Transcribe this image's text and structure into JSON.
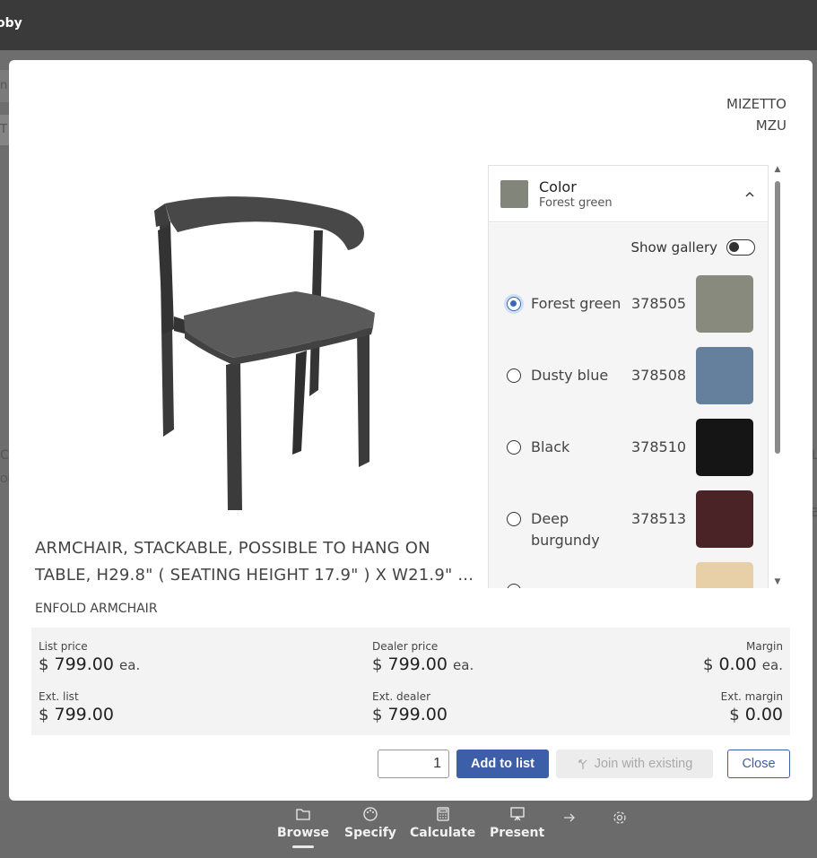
{
  "app": {
    "name": "oby"
  },
  "background": {
    "left_fragments": [
      "n",
      "T",
      "C",
      "OL"
    ],
    "right_fragments": [
      "L",
      "a"
    ]
  },
  "vendor": {
    "name": "MIZETTO",
    "code": "MZU"
  },
  "product": {
    "description": "ARMCHAIR, STACKABLE, POSSIBLE TO HANG ON TABLE, H29.8\" ( SEATING HEIGHT 17.9\" ) X W21.9\" ...",
    "name": "ENFOLD ARMCHAIR"
  },
  "option": {
    "title": "Color",
    "selected": "Forest green",
    "selected_color": "#82867a",
    "gallery_label": "Show gallery",
    "gallery_on": false,
    "items": [
      {
        "label": "Forest green",
        "code": "378505",
        "color": "#878a7c",
        "checked": true
      },
      {
        "label": "Dusty blue",
        "code": "378508",
        "color": "#64809c",
        "checked": false
      },
      {
        "label": "Black",
        "code": "378510",
        "color": "#151515",
        "checked": false
      },
      {
        "label": "Deep burgundy",
        "code": "378513",
        "color": "#4a2327",
        "checked": false
      },
      {
        "label": "",
        "code": "",
        "color": "#e7cfa8",
        "checked": false
      }
    ]
  },
  "pricing": {
    "list_price": {
      "label": "List price",
      "currency": "$",
      "amount": "799.00",
      "unit": "ea."
    },
    "dealer_price": {
      "label": "Dealer price",
      "currency": "$",
      "amount": "799.00",
      "unit": "ea."
    },
    "margin": {
      "label": "Margin",
      "currency": "$",
      "amount": "0.00",
      "unit": "ea."
    },
    "ext_list": {
      "label": "Ext. list",
      "currency": "$",
      "amount": "799.00"
    },
    "ext_dealer": {
      "label": "Ext. dealer",
      "currency": "$",
      "amount": "799.00"
    },
    "ext_margin": {
      "label": "Ext. margin",
      "currency": "$",
      "amount": "0.00"
    }
  },
  "actions": {
    "quantity": "1",
    "add_label": "Add to list",
    "join_label": "Join with existing",
    "close_label": "Close"
  },
  "nav": {
    "items": [
      {
        "label": "Browse",
        "icon": "folder-icon"
      },
      {
        "label": "Specify",
        "icon": "palette-icon"
      },
      {
        "label": "Calculate",
        "icon": "calculator-icon"
      },
      {
        "label": "Present",
        "icon": "presentation-icon"
      }
    ],
    "arrow_icon": "arrow-right-icon",
    "settings_icon": "gear-icon"
  }
}
